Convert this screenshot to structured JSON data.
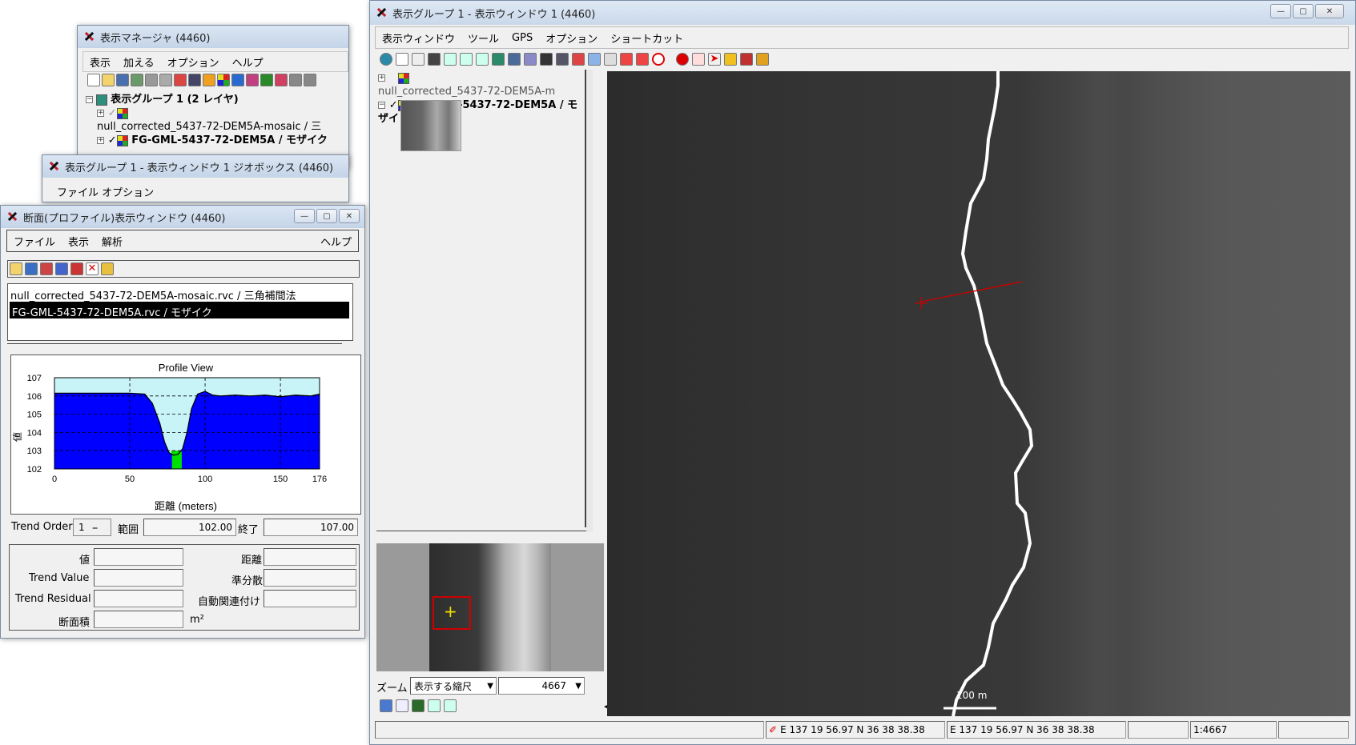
{
  "display_manager": {
    "title": "表示マネージャ (4460)",
    "menu": [
      "表示",
      "加える",
      "オプション",
      "ヘルプ"
    ],
    "group_label": "表示グループ 1  (2 レイヤ)",
    "layers": [
      "null_corrected_5437-72-DEM5A-mosaic / 三",
      "FG-GML-5437-72-DEM5A / モザイク"
    ]
  },
  "geobox_window": {
    "title": "表示グループ 1  - 表示ウィンドウ 1 ジオボックス (4460)",
    "menu_partial": "ファイル  オプション"
  },
  "profile_window": {
    "title": "断面(プロファイル)表示ウィンドウ (4460)",
    "menu": [
      "ファイル",
      "表示",
      "解析"
    ],
    "help": "ヘルプ",
    "layers": [
      "null_corrected_5437-72-DEM5A-mosaic.rvc / 三角補間法",
      "FG-GML-5437-72-DEM5A.rvc / モザイク"
    ],
    "trend_order_label": "Trend Order",
    "trend_order_value": "1",
    "range_label": "範囲",
    "range_value": "102.00",
    "end_label": "終了",
    "end_value": "107.00",
    "value_label": "値",
    "distance_label": "距離",
    "trend_value_label": "Trend Value",
    "semivariance_label": "準分散",
    "trend_residual_label": "Trend Residual",
    "autocorrelation_label": "自動関連付け",
    "area_label": "断面積",
    "area_unit": "m²"
  },
  "chart_data": {
    "type": "area",
    "title": "Profile View",
    "xlabel": "距離 (meters)",
    "ylabel": "値",
    "xlim": [
      0,
      176
    ],
    "ylim": [
      102,
      107
    ],
    "x_ticks": [
      "0",
      "50",
      "100",
      "150",
      "176"
    ],
    "y_ticks": [
      "107",
      "106",
      "105",
      "104",
      "103",
      "102"
    ],
    "grid": true,
    "x": [
      0,
      10,
      20,
      30,
      40,
      50,
      60,
      65,
      70,
      73,
      76,
      79,
      82,
      85,
      88,
      91,
      95,
      100,
      105,
      110,
      120,
      130,
      140,
      150,
      160,
      170,
      176
    ],
    "y": [
      106.15,
      106.15,
      106.15,
      106.15,
      106.15,
      106.15,
      106.1,
      105.6,
      104.5,
      103.5,
      102.9,
      102.75,
      102.8,
      103.1,
      104,
      105.3,
      106.1,
      106.25,
      106.05,
      106.0,
      106.05,
      106.0,
      106.05,
      105.95,
      106.05,
      106.0,
      106.1
    ],
    "fill_colors": {
      "terrain": "#0000ff",
      "below_reference": "#00e000",
      "sky": "#c8f4f8"
    }
  },
  "main_window": {
    "title": "表示グループ 1  - 表示ウィンドウ 1 (4460)",
    "menu": [
      "表示ウィンドウ",
      "ツール",
      "GPS",
      "オプション",
      "ショートカット"
    ],
    "layers": [
      "null_corrected_5437-72-DEM5A-m",
      "FG-GML-5437-72-DEM5A / モザイ"
    ],
    "zoom_label": "ズーム",
    "zoom_mode": "表示する縮尺",
    "zoom_value": "4667",
    "scalebar_label": "100 m",
    "coord_left": "E 137 19 56.97  N 36 38 38.38",
    "coord_right": "E 137 19 56.97  N 36 38 38.38",
    "scale_ratio": "1:4667"
  },
  "colors": {
    "titlebar": "#c9d8ea",
    "selected_row": "#000000",
    "map_background": "#2e2e2e",
    "profile_line": "#cc0000"
  }
}
